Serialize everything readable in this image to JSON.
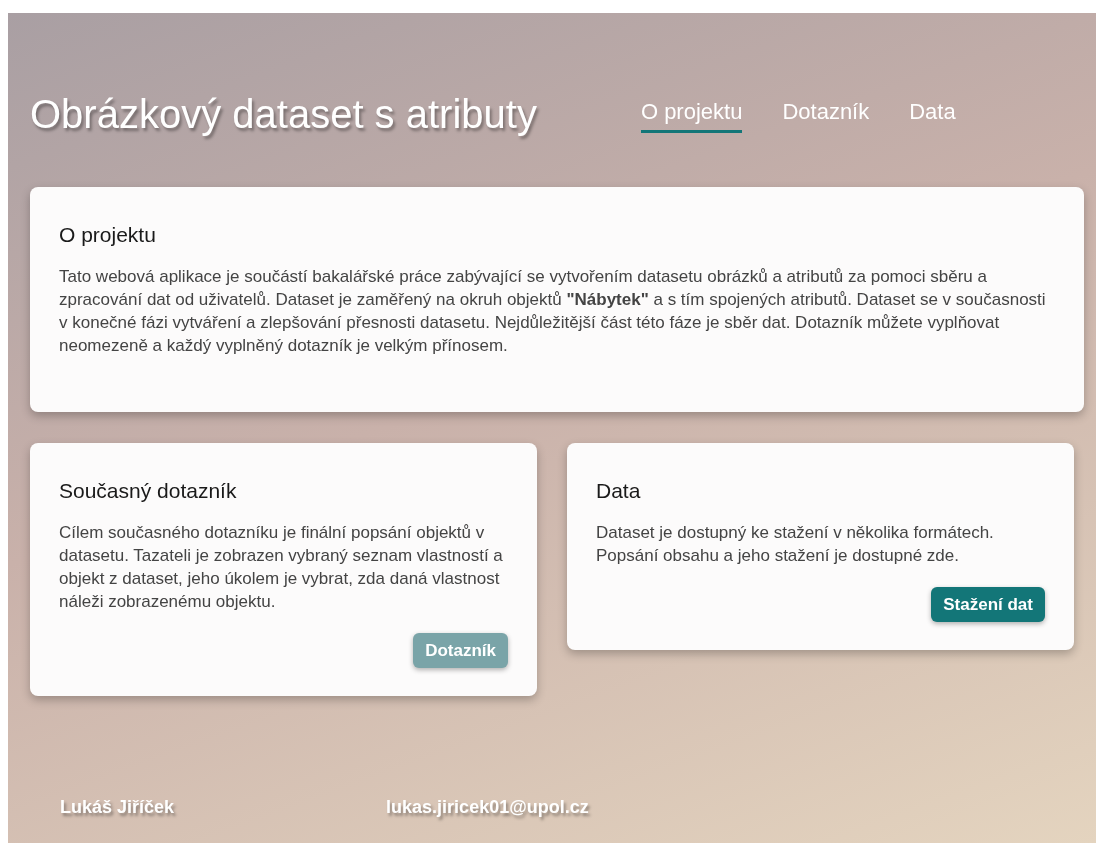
{
  "header": {
    "title": "Obrázkový dataset s atributy",
    "nav": [
      {
        "label": "O projektu",
        "selected": true
      },
      {
        "label": "Dotazník",
        "selected": false
      },
      {
        "label": "Data",
        "selected": false
      }
    ]
  },
  "intro_card": {
    "title": "O projektu",
    "text": "Tato webová aplikace je součástí bakalářské práce zabývající se vytvořením datasetu obrázků a atributů za pomoci sběru a zpracování dat od uživatelů. Dataset je zaměřený na okruh objektů **\"Nábytek\"** a s tím spojených atributů. Dataset se v současnosti v konečné fázi vytváření a zlepšování přesnosti datasetu. Nejdůležitější část této fáze je sběr dat. Dotazník můžete vyplňovat neomezeně a každý vyplněný dotazník je velkým přínosem."
  },
  "cards": [
    {
      "title": "Současný dotazník",
      "text": "Cílem současného dotazníku je finální popsání objektů v datasetu. Tazateli je zobrazen vybraný seznam vlastností a objekt z dataset, jeho úkolem je vybrat, zda daná vlastnost náleži zobrazenému objektu.",
      "button": {
        "label": "Dotazník",
        "disabled": true
      }
    },
    {
      "title": "Data",
      "text": "Dataset je dostupný ke stažení v několika formátech. Popsání obsahu a jeho stažení je dostupné zde.",
      "button": {
        "label": "Stažení dat",
        "disabled": false
      }
    }
  ],
  "footer": {
    "name": "Lukáš Jiříček",
    "email": "lukas.jiricek01@upol.cz"
  }
}
